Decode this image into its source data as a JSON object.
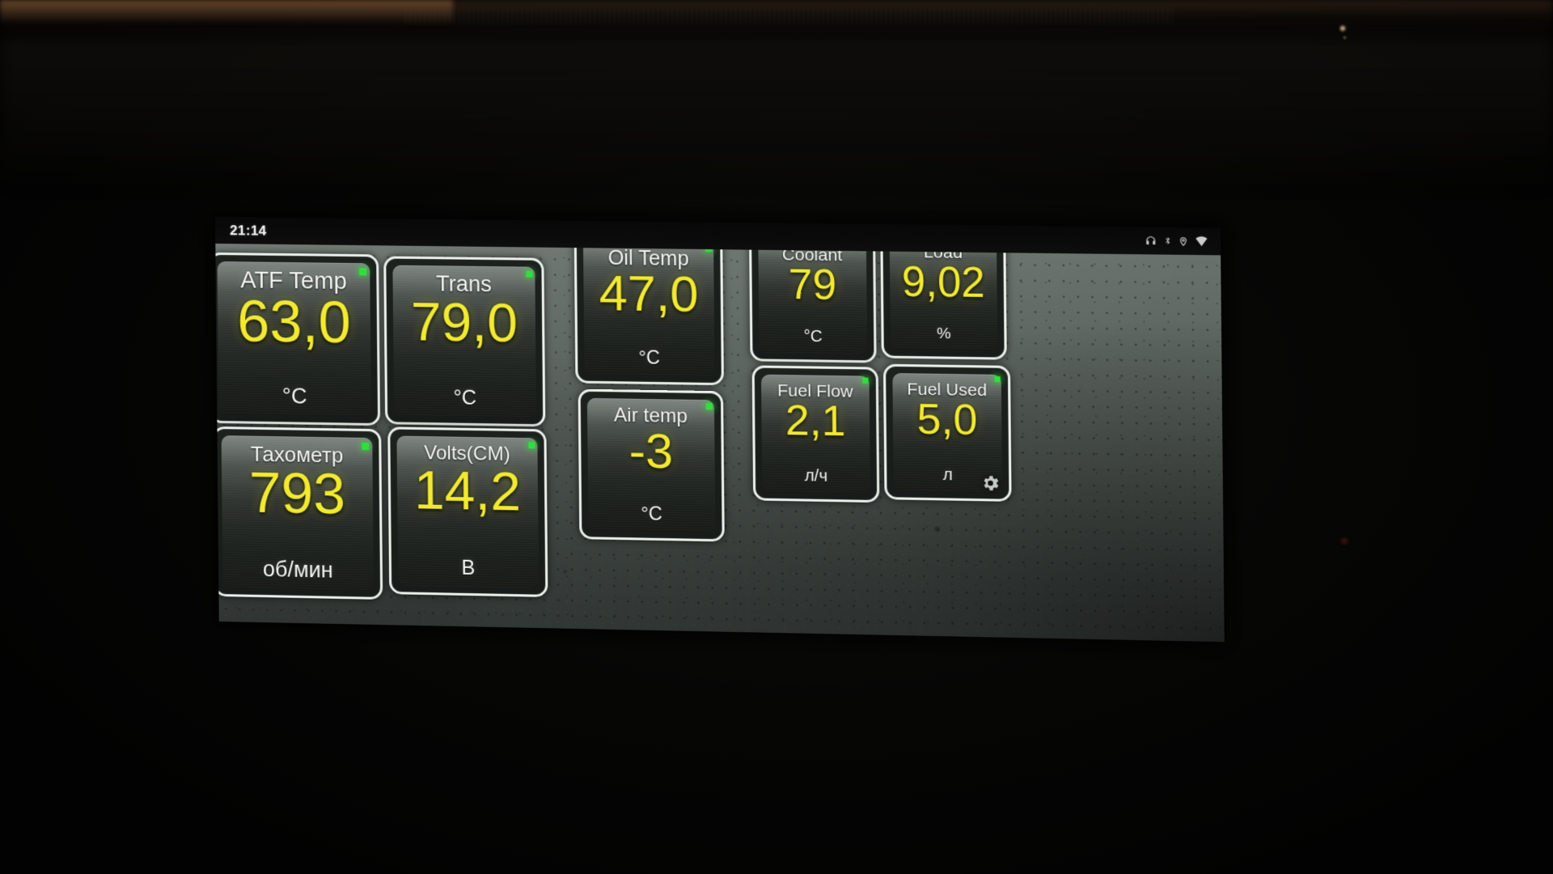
{
  "device": {
    "app_kind": "obd-dashboard",
    "accent_value_color": "#f2ea2e",
    "label_color": "#f2f5f2",
    "indicator_color": "#2ee03a",
    "tile_border_color": "#e9efe9"
  },
  "statusbar": {
    "clock": "21:14",
    "icons": [
      {
        "name": "headphones-icon",
        "glyph": "headphones"
      },
      {
        "name": "bluetooth-icon",
        "glyph": "bluetooth"
      },
      {
        "name": "location-icon",
        "glyph": "location"
      },
      {
        "name": "wifi-icon",
        "glyph": "wifi"
      }
    ]
  },
  "dashboard": {
    "settings_button_label": "gear-icon",
    "gauges": [
      {
        "id": "atf-temp",
        "label": "ATF Temp",
        "value": "63,0",
        "unit": "°C",
        "indicator": "connected"
      },
      {
        "id": "trans",
        "label": "Trans",
        "value": "79,0",
        "unit": "°C",
        "indicator": "connected"
      },
      {
        "id": "oil-temp",
        "label": "Oil Temp",
        "value": "47,0",
        "unit": "°C",
        "indicator": "connected"
      },
      {
        "id": "coolant",
        "label": "Coolant",
        "value": "79",
        "unit": "°C",
        "indicator": "connected"
      },
      {
        "id": "load",
        "label": "Load",
        "value": "9,02",
        "unit": "%",
        "indicator": "connected"
      },
      {
        "id": "tachometer",
        "label": "Тахометр",
        "value": "793",
        "unit": "об/мин",
        "indicator": "connected"
      },
      {
        "id": "volts-cm",
        "label": "Volts(CM)",
        "value": "14,2",
        "unit": "В",
        "indicator": "connected"
      },
      {
        "id": "air-temp",
        "label": "Air temp",
        "value": "-3",
        "unit": "°C",
        "indicator": "connected"
      },
      {
        "id": "fuel-flow",
        "label": "Fuel Flow",
        "value": "2,1",
        "unit": "л/ч",
        "indicator": "connected"
      },
      {
        "id": "fuel-used",
        "label": "Fuel Used",
        "value": "5,0",
        "unit": "л",
        "indicator": "connected"
      }
    ]
  }
}
